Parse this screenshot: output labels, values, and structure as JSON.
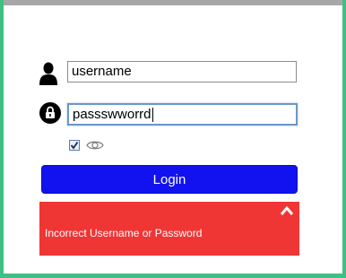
{
  "login": {
    "username_value": "username",
    "password_value": "passswworrd",
    "show_password_checked": true,
    "login_label": "Login",
    "error_message": "Incorrect Username or Password"
  },
  "colors": {
    "background": "#3fc083",
    "button": "#1212f0",
    "error": "#f03535"
  },
  "icons": [
    "user-icon",
    "lock-icon",
    "eye-icon",
    "chevron-up-icon"
  ]
}
